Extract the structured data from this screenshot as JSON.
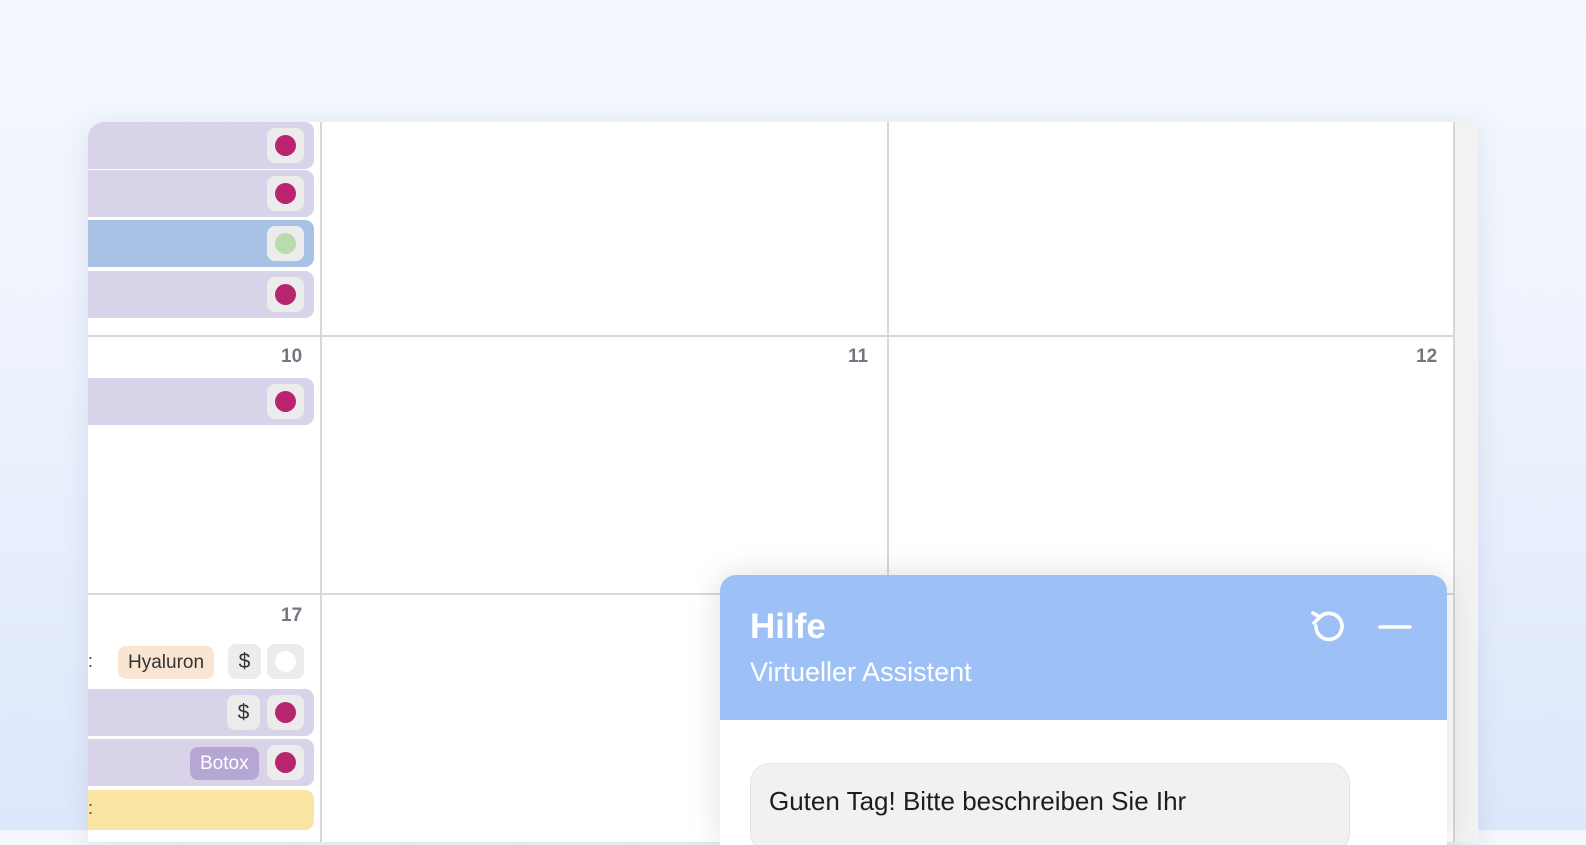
{
  "calendar": {
    "day_numbers": {
      "d10": "10",
      "d11": "11",
      "d12": "12",
      "d17": "17"
    },
    "status_colors": {
      "pink": "#b8246e",
      "green": "#b9dcae",
      "empty": "#ffffff"
    },
    "event_colors": {
      "lavender": "#d8d3e8",
      "blue": "#a7c2e5",
      "yellow": "#fae4a2"
    },
    "week1_events": [
      {
        "color": "lavender",
        "status": "pink"
      },
      {
        "color": "lavender",
        "status": "pink"
      },
      {
        "color": "blue",
        "status": "green"
      },
      {
        "color": "lavender",
        "status": "pink"
      }
    ],
    "day10_events": [
      {
        "color": "lavender",
        "status": "pink"
      }
    ],
    "day17": {
      "row1": {
        "colon": ":",
        "tag": "Hyaluron",
        "dollar": "$",
        "status": "empty"
      },
      "row2": {
        "dollar": "$",
        "status": "pink"
      },
      "row3": {
        "tag": "Botox",
        "status": "pink"
      },
      "row4": {
        "colon": ":",
        "color": "yellow"
      }
    }
  },
  "chat": {
    "title": "Hilfe",
    "subtitle": "Virtueller Assistent",
    "header_color": "#9dc1f6",
    "refresh_icon": "refresh-icon",
    "minimize_icon": "minimize-icon",
    "message": "Guten Tag! Bitte beschreiben Sie Ihr"
  }
}
